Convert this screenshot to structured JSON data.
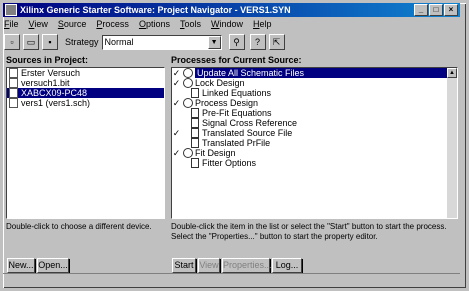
{
  "window": {
    "title": "Xilinx Generic Starter Software: Project Navigator - VERS1.SYN"
  },
  "menu": [
    "File",
    "View",
    "Source",
    "Process",
    "Options",
    "Tools",
    "Window",
    "Help"
  ],
  "toolbar": {
    "strategy_label": "Strategy",
    "strategy_value": "Normal"
  },
  "sources": {
    "label": "Sources in Project:",
    "items": [
      {
        "label": "Erster Versuch",
        "selected": false
      },
      {
        "label": "versuch1.bit",
        "selected": false
      },
      {
        "label": "XABCX09-PC48",
        "selected": true
      },
      {
        "label": "vers1 (vers1.sch)",
        "selected": false
      }
    ],
    "description": "Double-click to choose a different device."
  },
  "processes": {
    "label": "Processes for Current Source:",
    "items": [
      {
        "label": "Update All Schematic Files",
        "check": true,
        "kind": "proc",
        "indent": 0,
        "selected": true
      },
      {
        "label": "Lock Design",
        "check": true,
        "kind": "proc",
        "indent": 0,
        "selected": false
      },
      {
        "label": "Linked Equations",
        "check": false,
        "kind": "doc",
        "indent": 1,
        "selected": false
      },
      {
        "label": "Process Design",
        "check": true,
        "kind": "proc",
        "indent": 0,
        "selected": false
      },
      {
        "label": "Pre-Fit Equations",
        "check": false,
        "kind": "doc",
        "indent": 1,
        "selected": false
      },
      {
        "label": "Signal Cross Reference",
        "check": false,
        "kind": "doc",
        "indent": 1,
        "selected": false
      },
      {
        "label": "Translated Source File",
        "check": true,
        "kind": "doc",
        "indent": 1,
        "selected": false
      },
      {
        "label": "Translated PrFile",
        "check": false,
        "kind": "doc",
        "indent": 1,
        "selected": false
      },
      {
        "label": "Fit Design",
        "check": true,
        "kind": "proc",
        "indent": 0,
        "selected": false
      },
      {
        "label": "Fitter Options",
        "check": false,
        "kind": "doc",
        "indent": 1,
        "selected": false
      }
    ],
    "description": "Double-click the item in the list or select the \"Start\" button to start the process. Select the \"Properties...\" button to start the property editor."
  },
  "buttons": {
    "new": "New...",
    "open": "Open...",
    "start": "Start",
    "view": "View",
    "properties": "Properties...",
    "log": "Log..."
  }
}
